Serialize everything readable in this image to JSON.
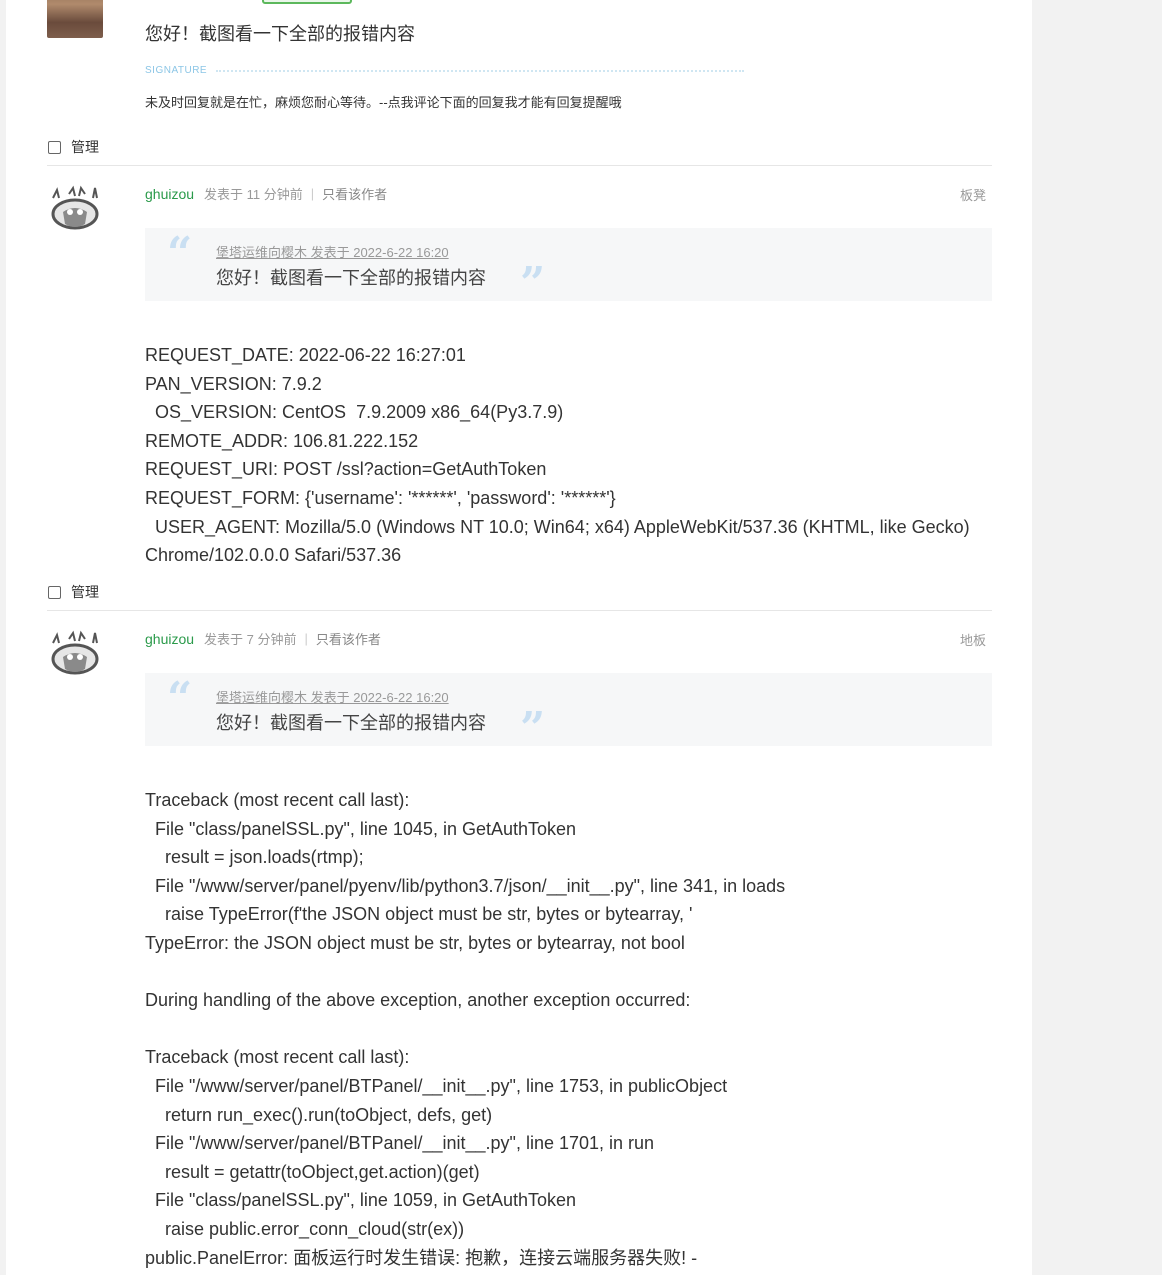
{
  "post0": {
    "text": "您好！截图看一下全部的报错内容",
    "signature_label": "SIGNATURE",
    "signature_text": "未及时回复就是在忙，麻烦您耐心等待。--点我评论下面的回复我才能有回复提醒哦",
    "manage_label": "管理"
  },
  "post1": {
    "author": "ghuizou",
    "time": "发表于 11 分钟前",
    "only_author": "只看该作者",
    "floor": "板凳",
    "quote_header": "堡塔运维向樱木 发表于 2022-6-22 16:20",
    "quote_text": "您好！截图看一下全部的报错内容",
    "lines": [
      "REQUEST_DATE: 2022-06-22 16:27:01",
      "PAN_VERSION: 7.9.2",
      "  OS_VERSION: CentOS  7.9.2009 x86_64(Py3.7.9)",
      "REMOTE_ADDR: 106.81.222.152",
      "REQUEST_URI: POST /ssl?action=GetAuthToken",
      "REQUEST_FORM: {'username': '******', 'password': '******'}",
      "  USER_AGENT: Mozilla/5.0 (Windows NT 10.0; Win64; x64) AppleWebKit/537.36 (KHTML, like Gecko)",
      "Chrome/102.0.0.0 Safari/537.36"
    ],
    "manage_label": "管理"
  },
  "post2": {
    "author": "ghuizou",
    "time": "发表于 7 分钟前",
    "only_author": "只看该作者",
    "floor": "地板",
    "quote_header": "堡塔运维向樱木 发表于 2022-6-22 16:20",
    "quote_text": "您好！截图看一下全部的报错内容",
    "lines": [
      "Traceback (most recent call last):",
      "  File \"class/panelSSL.py\", line 1045, in GetAuthToken",
      "    result = json.loads(rtmp);",
      "  File \"/www/server/panel/pyenv/lib/python3.7/json/__init__.py\", line 341, in loads",
      "    raise TypeError(f'the JSON object must be str, bytes or bytearray, '",
      "TypeError: the JSON object must be str, bytes or bytearray, not bool",
      "",
      "During handling of the above exception, another exception occurred:",
      "",
      "Traceback (most recent call last):",
      "  File \"/www/server/panel/BTPanel/__init__.py\", line 1753, in publicObject",
      "    return run_exec().run(toObject, defs, get)",
      "  File \"/www/server/panel/BTPanel/__init__.py\", line 1701, in run",
      "    result = getattr(toObject,get.action)(get)",
      "  File \"class/panelSSL.py\", line 1059, in GetAuthToken",
      "    raise public.error_conn_cloud(str(ex))",
      "public.PanelError: 面板运行时发生错误: 抱歉，连接云端服务器失败! -"
    ]
  }
}
